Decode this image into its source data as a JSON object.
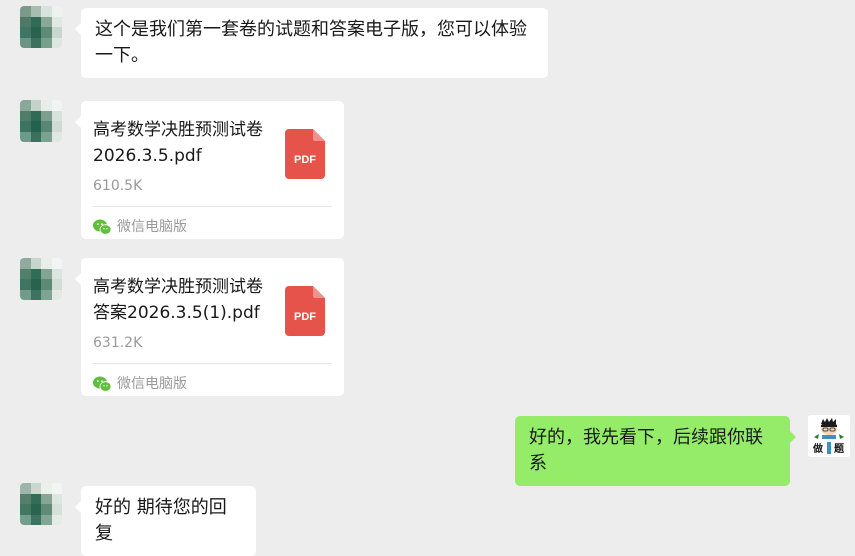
{
  "colors": {
    "chat_background": "#ededed",
    "incoming_bubble": "#ffffff",
    "outgoing_bubble": "#95ec69",
    "pdf_red": "#e5534b",
    "wechat_green": "#5fbf3b",
    "muted_text": "#9a9a9a"
  },
  "messages": [
    {
      "type": "text",
      "direction": "incoming",
      "text": "这个是我们第一套卷的试题和答案电子版，您可以体验一下。"
    },
    {
      "type": "file",
      "direction": "incoming",
      "file_name": "高考数学决胜预测试卷2026.3.5.pdf",
      "file_size": "610.5K",
      "file_icon": "pdf-file-icon",
      "file_icon_label": "PDF",
      "source_icon": "wechat-icon",
      "source": "微信电脑版"
    },
    {
      "type": "file",
      "direction": "incoming",
      "file_name": "高考数学决胜预测试卷答案2026.3.5(1).pdf",
      "file_size": "631.2K",
      "file_icon": "pdf-file-icon",
      "file_icon_label": "PDF",
      "source_icon": "wechat-icon",
      "source": "微信电脑版"
    },
    {
      "type": "text",
      "direction": "outgoing",
      "text": "好的，我先看下，后续跟你联系"
    },
    {
      "type": "text",
      "direction": "incoming",
      "text": "好的 期待您的回复"
    }
  ],
  "my_avatar": {
    "icon": "cartoon-avatar-icon",
    "label": "做题"
  }
}
